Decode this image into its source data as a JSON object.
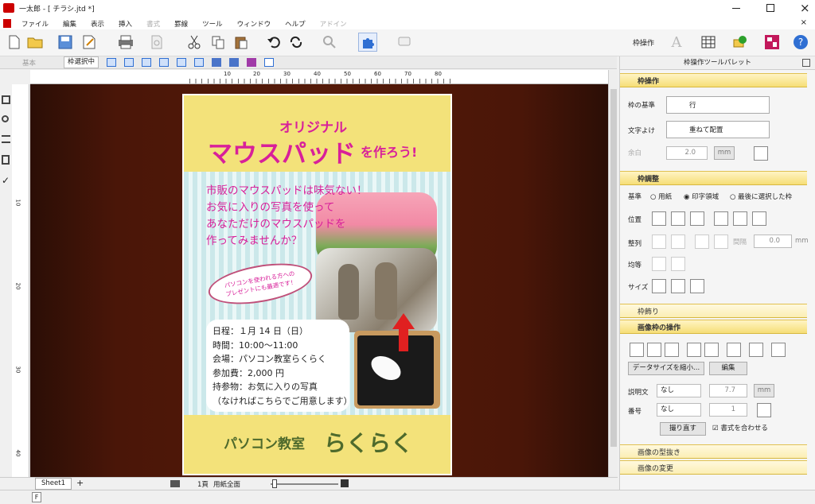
{
  "window": {
    "title": "一太郎 - [ チラシ.jtd *]"
  },
  "menu": [
    "ファイル",
    "編集",
    "表示",
    "挿入",
    "書式",
    "罫線",
    "ツール",
    "ウィンドウ",
    "ヘルプ",
    "アドイン"
  ],
  "menu_disabled": [
    "書式",
    "アドイン"
  ],
  "toolbar": {
    "frame_op_label": "枠操作"
  },
  "subtoolbar": {
    "tab_basic": "基本",
    "tab_frame": "枠選択中"
  },
  "ruler": {
    "h_ticks": [
      "10",
      "20",
      "30",
      "40",
      "50",
      "60",
      "70",
      "80"
    ],
    "v_ticks": [
      "10",
      "20",
      "30",
      "40"
    ]
  },
  "panel": {
    "title": "枠操作ツールパレット",
    "sec1": {
      "title": "枠操作",
      "kijun_label": "枠の基準",
      "kijun_value": "行",
      "moji_label": "文字よけ",
      "moji_value": "重ねて配置",
      "yohaku_label": "余白",
      "yohaku_value": "2.0",
      "yohaku_unit": "mm"
    },
    "sec2": {
      "title": "枠調整",
      "base_label": "基準",
      "opt1": "用紙",
      "opt2": "印字領域",
      "opt3": "最後に選択した枠",
      "pos_label": "位置",
      "align_label": "整列",
      "gap_label": "間隔",
      "gap_value": "0.0",
      "gap_unit": "mm",
      "equal_label": "均等",
      "size_label": "サイズ"
    },
    "sec3": {
      "title": "枠飾り"
    },
    "sec4": {
      "title": "画像枠の操作",
      "reduce_btn": "データサイズを縮小...",
      "edit_btn": "編集",
      "caption_label": "説明文",
      "caption_value": "なし",
      "caption_size": "7.7",
      "caption_unit": "mm",
      "num_label": "番号",
      "num_value": "なし",
      "num_size": "1",
      "recut_btn": "撮り直す",
      "fit_check": "書式を合わせる"
    },
    "sec5": {
      "title": "画像の型抜き"
    },
    "sec6": {
      "title": "画像の変更"
    }
  },
  "status": {
    "sheet": "Sheet1",
    "page": "1頁",
    "zoom_mode": "用紙全面"
  },
  "bottombar": {
    "mode": "F"
  },
  "flyer": {
    "title_top": "オリジナル",
    "title_main": "マウスパッド",
    "title_suffix": "を作ろう!",
    "intro": [
      "市販のマウスパッドは味気ない！",
      "お気に入りの写真を使って",
      "あなただけのマウスパッドを",
      "作ってみませんか？"
    ],
    "bubble": [
      "パソコンを使われる方への",
      "プレゼントにも最適です！"
    ],
    "details": [
      "日程：１月 14 日（日）",
      "時間：10:00～11:00",
      "会場：パソコン教室らくらく",
      "参加費：2,000 円",
      "持参物：お気に入りの写真",
      "（なければこちらでご用意します）"
    ],
    "footer_a": "パソコン教室",
    "footer_b": "らくらく"
  }
}
